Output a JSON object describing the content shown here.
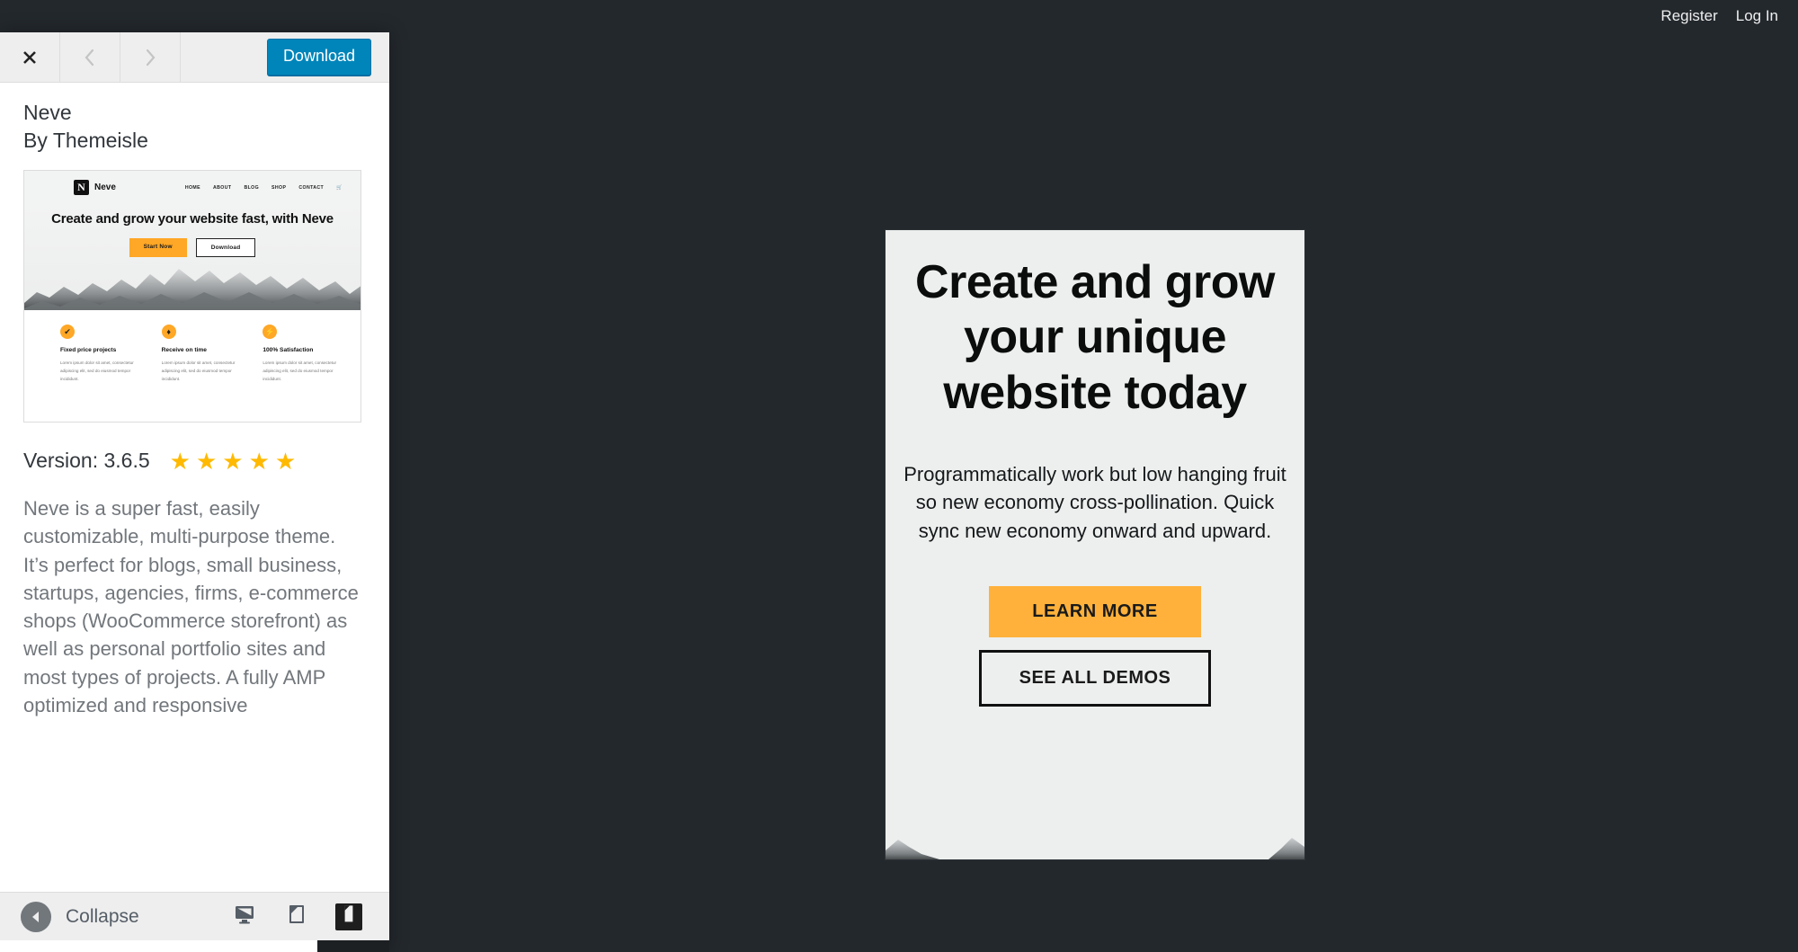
{
  "adminbar": {
    "items": [
      {
        "label": "Register",
        "name": "adminbar-register"
      },
      {
        "label": "Log In",
        "name": "adminbar-login"
      }
    ]
  },
  "sidebar": {
    "header": {
      "close_icon": "close-icon",
      "prev_icon": "chevron-left-icon",
      "next_icon": "chevron-right-icon",
      "download_label": "Download"
    },
    "theme": {
      "name": "Neve",
      "author": "By Themeisle",
      "version_label": "Version: 3.6.5",
      "rating_stars": 5,
      "star_glyph": "★",
      "description": "Neve is a super fast, easily customizable, multi-purpose theme. It’s perfect for blogs, small business, startups, agencies, firms, e-commerce shops (WooCommerce storefront) as well as personal portfolio sites and most types of projects. A fully AMP optimized and responsive"
    },
    "thumbnail": {
      "logo_letter": "N",
      "logo_text": "Neve",
      "menu": [
        "HOME",
        "ABOUT",
        "BLOG",
        "SHOP",
        "CONTACT"
      ],
      "cart_icon": "cart-icon",
      "headline": "Create and grow your website fast, with Neve",
      "primary_button": "Start Now",
      "secondary_button": "Download",
      "features": [
        {
          "icon": "check-icon",
          "glyph": "✔",
          "title": "Fixed price projects",
          "body": "Lorem ipsum dolor sit amet, consectetur adipiscing elit, sed do eiusmod tempor incididunt."
        },
        {
          "icon": "diamond-icon",
          "glyph": "♦",
          "title": "Receive on time",
          "body": "Lorem ipsum dolor sit amet, consectetur adipiscing elit, sed do eiusmod tempor incididunt."
        },
        {
          "icon": "bolt-icon",
          "glyph": "⚡",
          "title": "100% Satisfaction",
          "body": "Lorem ipsum dolor sit amet, consectetur adipiscing elit, sed do eiusmod tempor incididunt."
        }
      ]
    },
    "footer": {
      "collapse_label": "Collapse",
      "collapse_icon": "collapse-arrow-icon",
      "devices": [
        {
          "name": "device-desktop",
          "icon": "desktop-icon",
          "active": false
        },
        {
          "name": "device-tablet",
          "icon": "tablet-icon",
          "active": false
        },
        {
          "name": "device-mobile",
          "icon": "mobile-icon",
          "active": true
        }
      ]
    }
  },
  "preview": {
    "headline": "Create and grow your unique website today",
    "paragraph": "Programmatically work but low hanging fruit so new economy cross-pollination. Quick sync new economy onward and upward.",
    "learn_more_label": "LEARN MORE",
    "see_demos_label": "SEE ALL DEMOS"
  },
  "colors": {
    "admin_bar": "#23282d",
    "accent_blue": "#0085ba",
    "accent_orange": "#ffb13b",
    "star_gold": "#ffb900",
    "preview_bg": "#edefee"
  }
}
